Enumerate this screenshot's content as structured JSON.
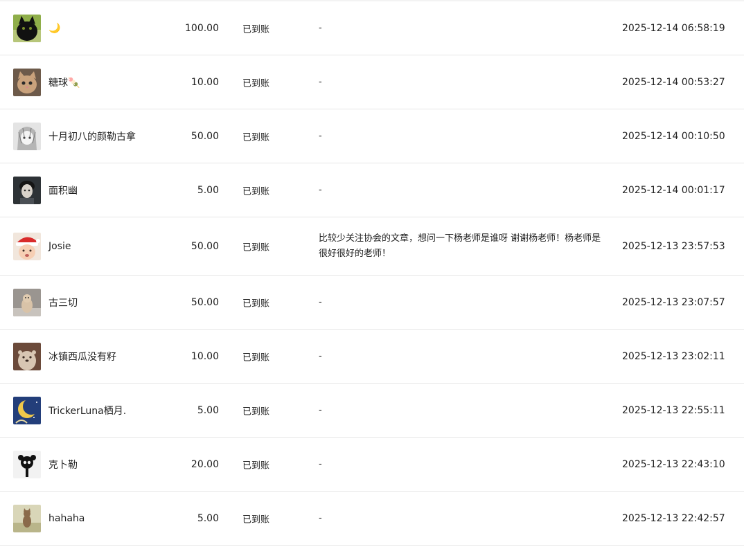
{
  "donations": [
    {
      "name": "🌙",
      "amount": "100.00",
      "status": "已到账",
      "message": "-",
      "time": "2025-12-14 06:58:19",
      "avatar_icon": "black-cat-avatar-icon"
    },
    {
      "name": "糖球🍡",
      "amount": "10.00",
      "status": "已到账",
      "message": "-",
      "time": "2025-12-14 00:53:27",
      "avatar_icon": "kitten-avatar-icon"
    },
    {
      "name": "十月初八的颜勒古拿",
      "amount": "50.00",
      "status": "已到账",
      "message": "-",
      "time": "2025-12-14 00:10:50",
      "avatar_icon": "anime-sketch-avatar-icon"
    },
    {
      "name": "面积幽",
      "amount": "5.00",
      "status": "已到账",
      "message": "-",
      "time": "2025-12-14 00:01:17",
      "avatar_icon": "portrait-avatar-icon"
    },
    {
      "name": "Josie",
      "amount": "50.00",
      "status": "已到账",
      "message": "比较少关注协会的文章，想问一下杨老师是谁呀 谢谢杨老师！杨老师是很好很好的老师！",
      "time": "2025-12-13 23:57:53",
      "avatar_icon": "baby-santa-avatar-icon"
    },
    {
      "name": "古三切",
      "amount": "50.00",
      "status": "已到账",
      "message": "-",
      "time": "2025-12-13 23:07:57",
      "avatar_icon": "cat-photo-avatar-icon"
    },
    {
      "name": "冰镇西瓜没有籽",
      "amount": "10.00",
      "status": "已到账",
      "message": "-",
      "time": "2025-12-13 23:02:11",
      "avatar_icon": "otter-avatar-icon"
    },
    {
      "name": "TrickerLuna栖月.",
      "amount": "5.00",
      "status": "已到账",
      "message": "-",
      "time": "2025-12-13 22:55:11",
      "avatar_icon": "crescent-moon-avatar-icon"
    },
    {
      "name": "克卜勒",
      "amount": "20.00",
      "status": "已到账",
      "message": "-",
      "time": "2025-12-13 22:43:10",
      "avatar_icon": "silhouette-avatar-icon"
    },
    {
      "name": "hahaha",
      "amount": "5.00",
      "status": "已到账",
      "message": "-",
      "time": "2025-12-13 22:42:57",
      "avatar_icon": "cat-outdoor-avatar-icon"
    }
  ]
}
